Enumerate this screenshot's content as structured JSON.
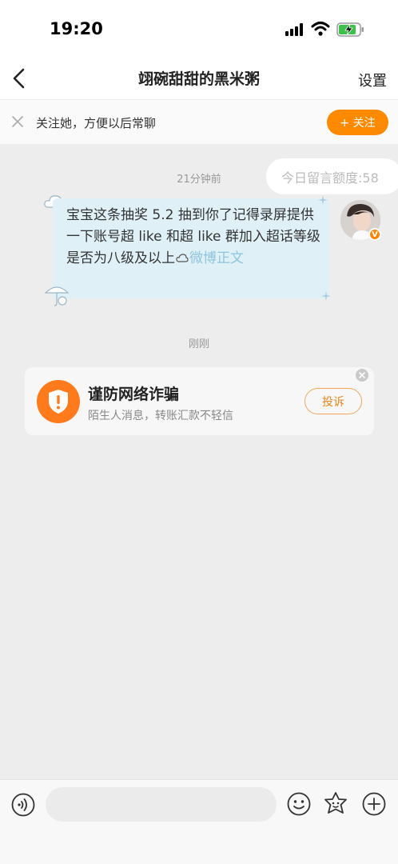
{
  "status_bar": {
    "time": "19:20",
    "icons": [
      "signal-icon",
      "wifi-icon",
      "battery-charging-icon"
    ],
    "battery_color": "#3cc24a"
  },
  "nav": {
    "title": "翊碗甜甜的黑米粥",
    "settings_label": "设置",
    "back_icon": "chevron-left-icon"
  },
  "follow_bar": {
    "text": "关注她，方便以后常聊",
    "button_label": "+ 关注",
    "button_color": "#ff8a00"
  },
  "chat": {
    "quota_text": "今日留言额度:58",
    "messages": [
      {
        "time": "21分钟前",
        "text": "宝宝这条抽奖 5.2 抽到你了记得录屏提供一下账号超 like 和超 like 群加入超话等级是否为八级及以上",
        "link_text": "微博正文",
        "bubble_color": "#dff1f7",
        "verified_badge": "V"
      }
    ],
    "second_time": "刚刚"
  },
  "fraud_card": {
    "title": "谨防网络诈骗",
    "subtitle": "陌生人消息，转账汇款不轻信",
    "report_label": "投诉",
    "accent_color": "#ff7a1a"
  },
  "input_bar": {
    "placeholder": "",
    "icons": [
      "voice-icon",
      "emoji-icon",
      "sticker-icon",
      "plus-icon"
    ]
  }
}
